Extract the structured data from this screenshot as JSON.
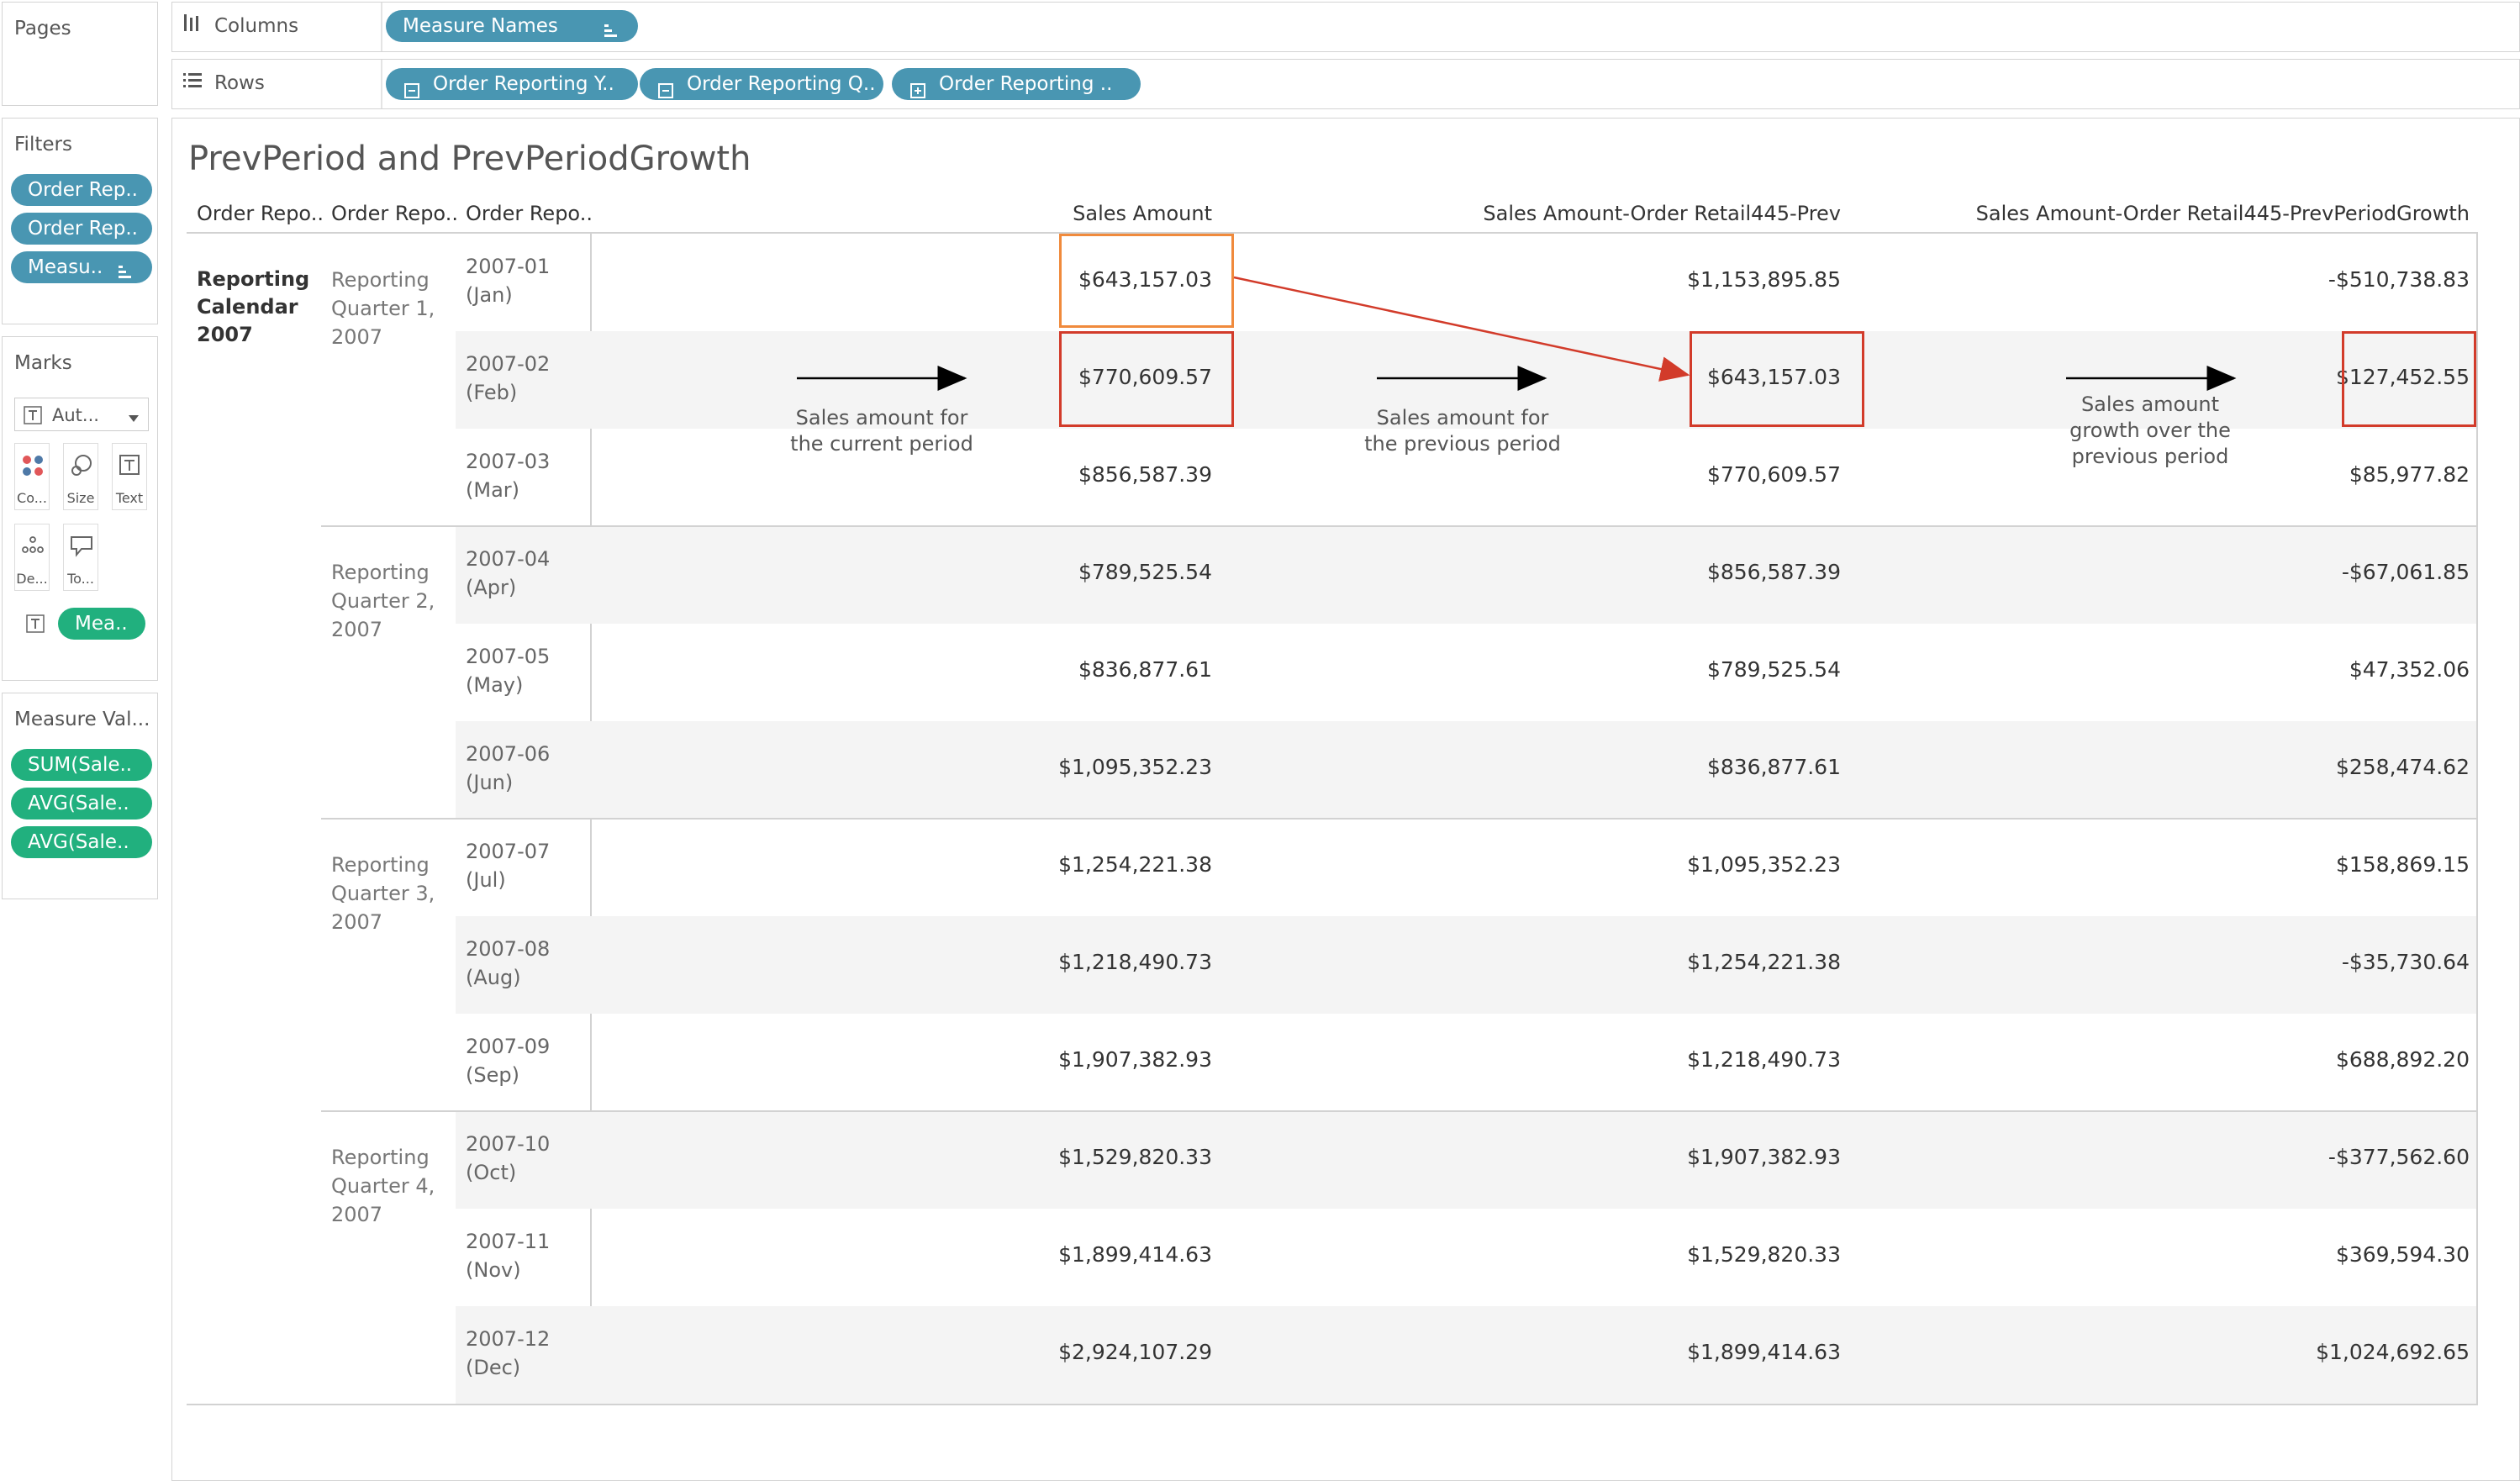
{
  "shelves": {
    "pages_label": "Pages",
    "columns_label": "Columns",
    "rows_label": "Rows",
    "columns_pill": "Measure Names",
    "rows_pills": [
      "Order Reporting Y..",
      "Order Reporting Q..",
      "Order Reporting .."
    ]
  },
  "filters": {
    "title": "Filters",
    "pills": [
      "Order Rep..",
      "Order Rep..",
      "Measu.."
    ]
  },
  "marks": {
    "title": "Marks",
    "mark_type": "Aut...",
    "buttons": [
      "Co...",
      "Size",
      "Text",
      "De...",
      "To..."
    ],
    "text_pill": "Mea.."
  },
  "measure_values": {
    "title": "Measure Val...",
    "pills": [
      "SUM(Sale..",
      "AVG(Sale..",
      "AVG(Sale.."
    ]
  },
  "view": {
    "title": "PrevPeriod and PrevPeriodGrowth",
    "row_headers": [
      "Order Repo..",
      "Order Repo..",
      "Order Repo.."
    ],
    "col_headers": [
      "Sales Amount",
      "Sales Amount-Order Retail445-Prev",
      "Sales Amount-Order Retail445-PrevPeriodGrowth"
    ],
    "year_label": [
      "Reporting",
      "Calendar",
      "2007"
    ],
    "quarters": [
      [
        "Reporting",
        "Quarter 1,",
        "2007"
      ],
      [
        "Reporting",
        "Quarter 2,",
        "2007"
      ],
      [
        "Reporting",
        "Quarter 3,",
        "2007"
      ],
      [
        "Reporting",
        "Quarter 4,",
        "2007"
      ]
    ],
    "rows": [
      {
        "month": [
          "2007-01",
          "(Jan)"
        ],
        "sales": "$643,157.03",
        "prev": "$1,153,895.85",
        "growth": "-$510,738.83"
      },
      {
        "month": [
          "2007-02",
          "(Feb)"
        ],
        "sales": "$770,609.57",
        "prev": "$643,157.03",
        "growth": "$127,452.55"
      },
      {
        "month": [
          "2007-03",
          "(Mar)"
        ],
        "sales": "$856,587.39",
        "prev": "$770,609.57",
        "growth": "$85,977.82"
      },
      {
        "month": [
          "2007-04",
          "(Apr)"
        ],
        "sales": "$789,525.54",
        "prev": "$856,587.39",
        "growth": "-$67,061.85"
      },
      {
        "month": [
          "2007-05",
          "(May)"
        ],
        "sales": "$836,877.61",
        "prev": "$789,525.54",
        "growth": "$47,352.06"
      },
      {
        "month": [
          "2007-06",
          "(Jun)"
        ],
        "sales": "$1,095,352.23",
        "prev": "$836,877.61",
        "growth": "$258,474.62"
      },
      {
        "month": [
          "2007-07",
          "(Jul)"
        ],
        "sales": "$1,254,221.38",
        "prev": "$1,095,352.23",
        "growth": "$158,869.15"
      },
      {
        "month": [
          "2007-08",
          "(Aug)"
        ],
        "sales": "$1,218,490.73",
        "prev": "$1,254,221.38",
        "growth": "-$35,730.64"
      },
      {
        "month": [
          "2007-09",
          "(Sep)"
        ],
        "sales": "$1,907,382.93",
        "prev": "$1,218,490.73",
        "growth": "$688,892.20"
      },
      {
        "month": [
          "2007-10",
          "(Oct)"
        ],
        "sales": "$1,529,820.33",
        "prev": "$1,907,382.93",
        "growth": "-$377,562.60"
      },
      {
        "month": [
          "2007-11",
          "(Nov)"
        ],
        "sales": "$1,899,414.63",
        "prev": "$1,529,820.33",
        "growth": "$369,594.30"
      },
      {
        "month": [
          "2007-12",
          "(Dec)"
        ],
        "sales": "$2,924,107.29",
        "prev": "$1,899,414.63",
        "growth": "$1,024,692.65"
      }
    ],
    "annotations": {
      "current": [
        "Sales amount for",
        "the current period"
      ],
      "previous": [
        "Sales amount for",
        "the previous period"
      ],
      "growth": [
        "Sales amount",
        "growth over the",
        "previous period"
      ]
    }
  },
  "colors": {
    "pill_green": "#21b07e",
    "pill_blue": "#4996b2",
    "highlight_red": "#d23b2a",
    "highlight_orange": "#f08a3c"
  }
}
